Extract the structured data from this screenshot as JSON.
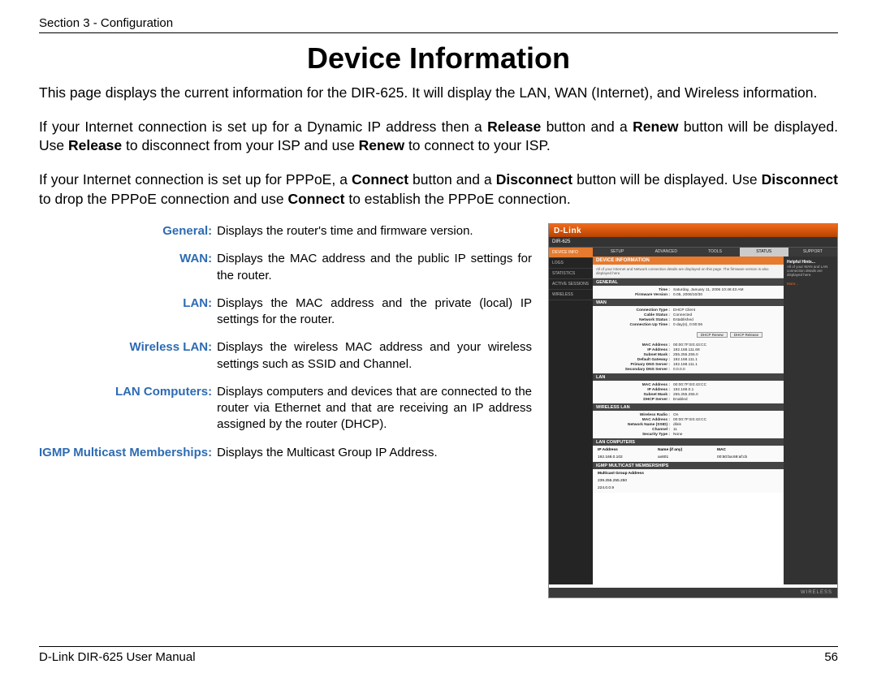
{
  "header": "Section 3 - Configuration",
  "title": "Device Information",
  "paragraphs": {
    "p1": "This page displays the current information for the DIR-625. It will display the LAN, WAN (Internet), and Wireless information.",
    "p2a": "If your Internet connection is set up for a Dynamic IP address then a ",
    "p2b": "Release",
    "p2c": " button and a ",
    "p2d": "Renew",
    "p2e": " button will be displayed. Use ",
    "p2f": "Release",
    "p2g": " to disconnect from your ISP and use ",
    "p2h": "Renew",
    "p2i": " to connect to your ISP.",
    "p3a": "If your Internet connection is set up for PPPoE, a ",
    "p3b": "Connect",
    "p3c": " button and a ",
    "p3d": "Disconnect",
    "p3e": " button will be displayed. Use ",
    "p3f": "Disconnect",
    "p3g": " to drop the PPPoE connection and use ",
    "p3h": "Connect",
    "p3i": " to establish the PPPoE connection."
  },
  "defs": [
    {
      "term": "General:",
      "desc": "Displays the router's time and firmware version."
    },
    {
      "term": "WAN:",
      "desc": "Displays the MAC address and the public IP settings for the router."
    },
    {
      "term": "LAN:",
      "desc": "Displays the MAC address and the private (local) IP settings for the router."
    },
    {
      "term": "Wireless LAN:",
      "desc": "Displays the wireless MAC address and your wireless settings such as SSID and Channel."
    },
    {
      "term": "LAN Computers:",
      "desc": "Displays computers and devices that are connected to the router via Ethernet and that are receiving an IP address assigned by the router (DHCP)."
    },
    {
      "term": "IGMP Multicast Memberships:",
      "desc": "Displays the Multicast Group IP Address."
    }
  ],
  "shot": {
    "brand": "D-Link",
    "model": "DIR-625",
    "nav": [
      "DEVICE INFO",
      "LOGS",
      "STATISTICS",
      "ACTIVE SESSIONS",
      "WIRELESS"
    ],
    "tabs": [
      "SETUP",
      "ADVANCED",
      "TOOLS",
      "STATUS",
      "SUPPORT"
    ],
    "activeTab": "STATUS",
    "panelTitle": "DEVICE INFORMATION",
    "panelDesc": "All of your Internet and Network connection details are displayed on this page. The firmware version is also displayed here.",
    "hintsTitle": "Helpful Hints...",
    "hintsBody": "All of your WAN and LAN connection details are displayed here.",
    "hintsMore": "More...",
    "sections": {
      "general": {
        "title": "GENERAL",
        "rows": [
          {
            "k": "Time :",
            "v": "Saturday, January 11, 2006 10:46:43 AM"
          },
          {
            "k": "Firmware Version :",
            "v": "0.05,  2006/10/30"
          }
        ]
      },
      "wan": {
        "title": "WAN",
        "rows": [
          {
            "k": "Connection Type :",
            "v": "DHCP Client"
          },
          {
            "k": "Cable Status :",
            "v": "Connected"
          },
          {
            "k": "Network Status :",
            "v": "Established"
          },
          {
            "k": "Connection Up Time :",
            "v": "0 day(s), 0:00:06"
          },
          {
            "k": "",
            "v": ""
          },
          {
            "k": "MAC Address :",
            "v": "00:00:7F:E0:43:CC"
          },
          {
            "k": "IP Address :",
            "v": "192.168.111.68"
          },
          {
            "k": "Subnet Mask :",
            "v": "255.255.255.0"
          },
          {
            "k": "Default Gateway :",
            "v": "192.168.111.1"
          },
          {
            "k": "Primary DNS Server :",
            "v": "192.168.111.1"
          },
          {
            "k": "Secondary DNS Server :",
            "v": "0.0.0.0"
          }
        ],
        "btnRenew": "DHCP Renew",
        "btnRelease": "DHCP Release"
      },
      "lan": {
        "title": "LAN",
        "rows": [
          {
            "k": "MAC Address :",
            "v": "00:00:7F:E0:43:CC"
          },
          {
            "k": "IP Address :",
            "v": "192.168.0.1"
          },
          {
            "k": "Subnet Mask :",
            "v": "255.255.255.0"
          },
          {
            "k": "DHCP Server :",
            "v": "Enabled"
          }
        ]
      },
      "wlan": {
        "title": "WIRELESS LAN",
        "rows": [
          {
            "k": "Wireless Radio :",
            "v": "On"
          },
          {
            "k": "MAC Address :",
            "v": "00:00:7F:E0:43:CC"
          },
          {
            "k": "Network Name (SSID) :",
            "v": "dlink"
          },
          {
            "k": "Channel :",
            "v": "11"
          },
          {
            "k": "Security Type :",
            "v": "None"
          }
        ]
      },
      "lancomp": {
        "title": "LAN COMPUTERS",
        "cols": [
          "IP Address",
          "Name (if any)",
          "MAC"
        ],
        "row": [
          "192.168.0.102",
          "ax601",
          "00:50:ba:69:af:cb"
        ]
      },
      "igmp": {
        "title": "IGMP MULTICAST MEMBERSHIPS",
        "col": "Multicast Group Address",
        "rows": [
          "239.255.255.250",
          "224.0.0.9"
        ]
      }
    },
    "footer": "WIRELESS"
  },
  "footer": {
    "left": "D-Link DIR-625 User Manual",
    "right": "56"
  }
}
